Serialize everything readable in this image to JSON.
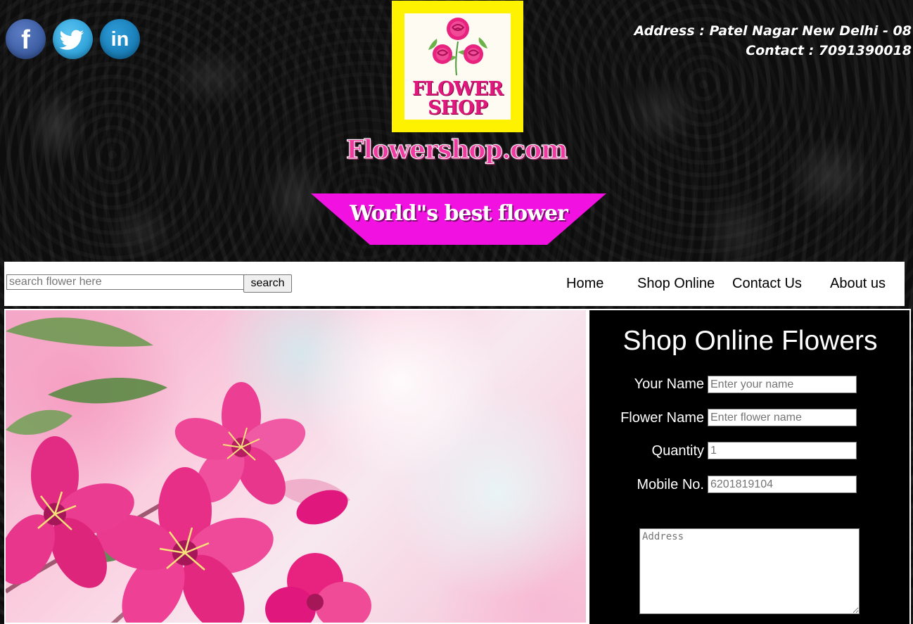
{
  "social": [
    {
      "name": "facebook",
      "glyph": "f",
      "icon": "facebook-icon"
    },
    {
      "name": "twitter",
      "glyph": "",
      "icon": "twitter-icon"
    },
    {
      "name": "linkedin",
      "glyph": "in",
      "icon": "linkedin-icon"
    }
  ],
  "header": {
    "address": "Address : Patel Nagar New Delhi - 08",
    "contact": "Contact : 7091390018",
    "logo_text": "FLOWER\nSHOP",
    "site_name": "Flowershop.com",
    "tagline": "World\"s best flower"
  },
  "nav": {
    "search_placeholder": "search flower here",
    "search_button": "search",
    "links": [
      "Home",
      "Shop Online",
      "Contact Us",
      "About us"
    ]
  },
  "form": {
    "title": "Shop Online Flowers",
    "fields": [
      {
        "label": "Your Name",
        "placeholder": "Enter your name"
      },
      {
        "label": "Flower Name",
        "placeholder": "Enter flower name"
      },
      {
        "label": "Quantity",
        "placeholder": "1"
      },
      {
        "label": "Mobile No.",
        "placeholder": "6201819104"
      }
    ],
    "address_placeholder": "Address"
  },
  "colors": {
    "logo_yellow": "#fff200",
    "brand_pink": "#e0177d",
    "tagline_magenta": "#f112e1"
  }
}
